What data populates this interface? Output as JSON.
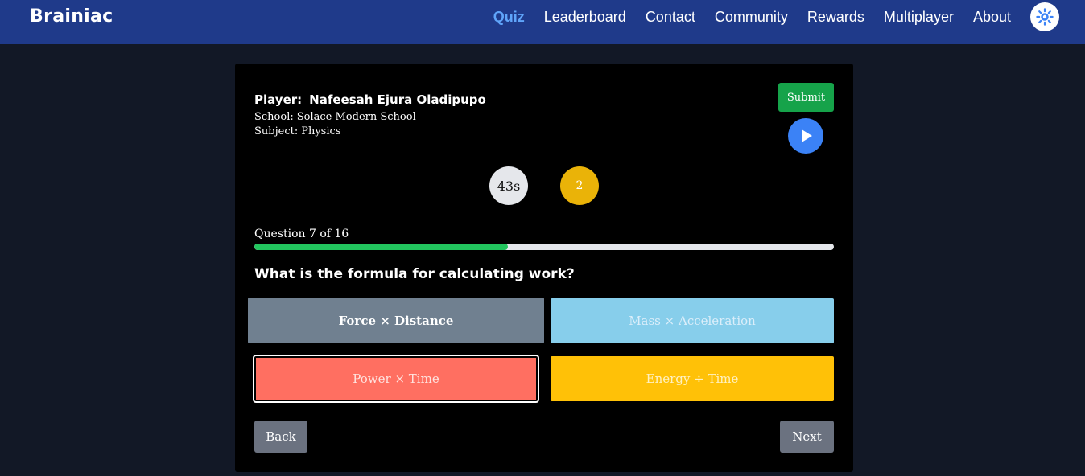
{
  "app": {
    "brand": "Brainiac"
  },
  "nav": {
    "items": [
      {
        "label": "Quiz",
        "active": true
      },
      {
        "label": "Leaderboard",
        "active": false
      },
      {
        "label": "Contact",
        "active": false
      },
      {
        "label": "Community",
        "active": false
      },
      {
        "label": "Rewards",
        "active": false
      },
      {
        "label": "Multiplayer",
        "active": false
      },
      {
        "label": "About",
        "active": false
      }
    ],
    "theme_toggle_icon": "sun-icon"
  },
  "player": {
    "name_label": "Player:",
    "name": "Nafeesah Ejura Oladipupo",
    "school_label": "School:",
    "school": "Solace Modern School",
    "subject_label": "Subject:",
    "subject": "Physics"
  },
  "controls": {
    "submit_label": "Submit",
    "play_icon": "play-icon",
    "back_label": "Back",
    "next_label": "Next"
  },
  "status": {
    "timer": "43s",
    "score": "2"
  },
  "progress": {
    "label": "Question 7 of 16",
    "fraction": 0.4375
  },
  "question": {
    "text": "What is the formula for calculating work?",
    "options": [
      {
        "label": "Force × Distance",
        "state": "hovered"
      },
      {
        "label": "Mass × Acceleration",
        "state": "default"
      },
      {
        "label": "Power × Time",
        "state": "selected"
      },
      {
        "label": "Energy ÷ Time",
        "state": "default"
      }
    ]
  },
  "colors": {
    "navbar": "#1f3a8a",
    "page_bg": "#121826",
    "nav_active": "#60a5fa",
    "submit": "#16a34a",
    "play": "#3b82f6",
    "progress_fill": "#22c55e",
    "option_a": "#708090",
    "option_b": "#87ceeb",
    "option_c": "#ff6f61",
    "option_d": "#ffc107",
    "score_badge": "#eab308"
  }
}
